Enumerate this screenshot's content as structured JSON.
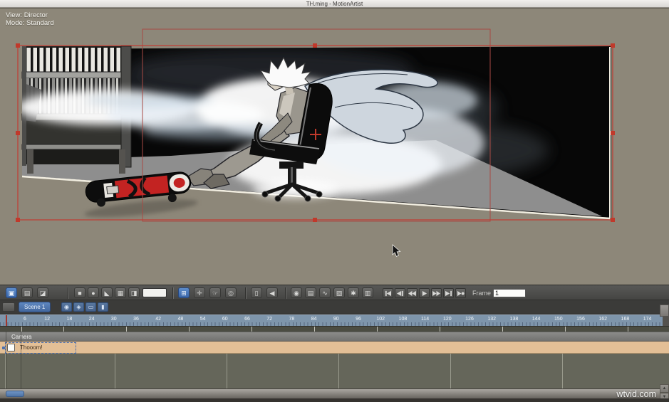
{
  "window": {
    "title": "TH.ming - MotionArtist"
  },
  "viewport": {
    "view_label": "View: Director",
    "mode_label": "Mode: Standard"
  },
  "toolbar": {
    "view_buttons": [
      {
        "name": "director-view-button",
        "glyph": "▣",
        "selected": true
      },
      {
        "name": "layer-view-button",
        "glyph": "▤",
        "selected": false
      },
      {
        "name": "split-view-button",
        "glyph": "◪",
        "selected": false
      }
    ],
    "shape_buttons": [
      {
        "name": "rectangle-tool-button",
        "glyph": "■"
      },
      {
        "name": "ellipse-tool-button",
        "glyph": "●"
      },
      {
        "name": "polygon-tool-button",
        "glyph": "◣"
      },
      {
        "name": "grid-tool-button",
        "glyph": "▦"
      },
      {
        "name": "mask-tool-button",
        "glyph": "◨"
      }
    ],
    "nav_buttons": [
      {
        "name": "select-tool-button",
        "glyph": "⊞",
        "selected": true
      },
      {
        "name": "move-tool-button",
        "glyph": "✛",
        "selected": false
      },
      {
        "name": "pan-tool-button",
        "glyph": "☞",
        "selected": false
      },
      {
        "name": "zoom-tool-button",
        "glyph": "◎",
        "selected": false
      }
    ],
    "audio_buttons": [
      {
        "name": "microphone-button",
        "glyph": "▯"
      },
      {
        "name": "speaker-button",
        "glyph": "◀"
      }
    ],
    "action_buttons": [
      {
        "name": "record-keyframe-button",
        "glyph": "◉"
      },
      {
        "name": "clipboard-button",
        "glyph": "▤"
      },
      {
        "name": "motion-path-button",
        "glyph": "∿"
      },
      {
        "name": "hatch-fill-button",
        "glyph": "▨"
      },
      {
        "name": "effects-button",
        "glyph": "✱"
      },
      {
        "name": "script-list-button",
        "glyph": "▥"
      }
    ],
    "transport": [
      "Go to start",
      "Previous keyframe",
      "Step back",
      "Play",
      "Step forward",
      "Next keyframe",
      "Go to end"
    ],
    "frame_label": "Frame",
    "frame_value": "1"
  },
  "scene_bar": {
    "tab_label": "Scene 1",
    "icons": [
      {
        "name": "visibility-toggle",
        "glyph": "◉"
      },
      {
        "name": "camera-toggle",
        "glyph": "◈"
      },
      {
        "name": "preview-toggle",
        "glyph": "▭"
      },
      {
        "name": "track-height-toggle",
        "glyph": "▮"
      }
    ]
  },
  "timeline": {
    "ruler_labels": [
      6,
      12,
      18,
      24,
      30,
      36,
      42,
      48,
      54,
      60,
      66,
      72,
      78,
      84,
      90,
      96,
      102,
      108,
      114,
      120,
      126,
      132,
      138,
      144,
      150,
      156,
      162,
      168,
      174
    ],
    "playhead_frame": "1",
    "group_label": "Camera",
    "track": {
      "name": "Thooom!"
    }
  },
  "watermark": {
    "text": "wtvid.com"
  },
  "colors": {
    "accent_blue": "#4d7fc4",
    "selection_red": "#c23b32",
    "track_tan": "#e3bf96",
    "ruler_blue": "#7e95ab",
    "canvas_gray": "#8d8779"
  }
}
